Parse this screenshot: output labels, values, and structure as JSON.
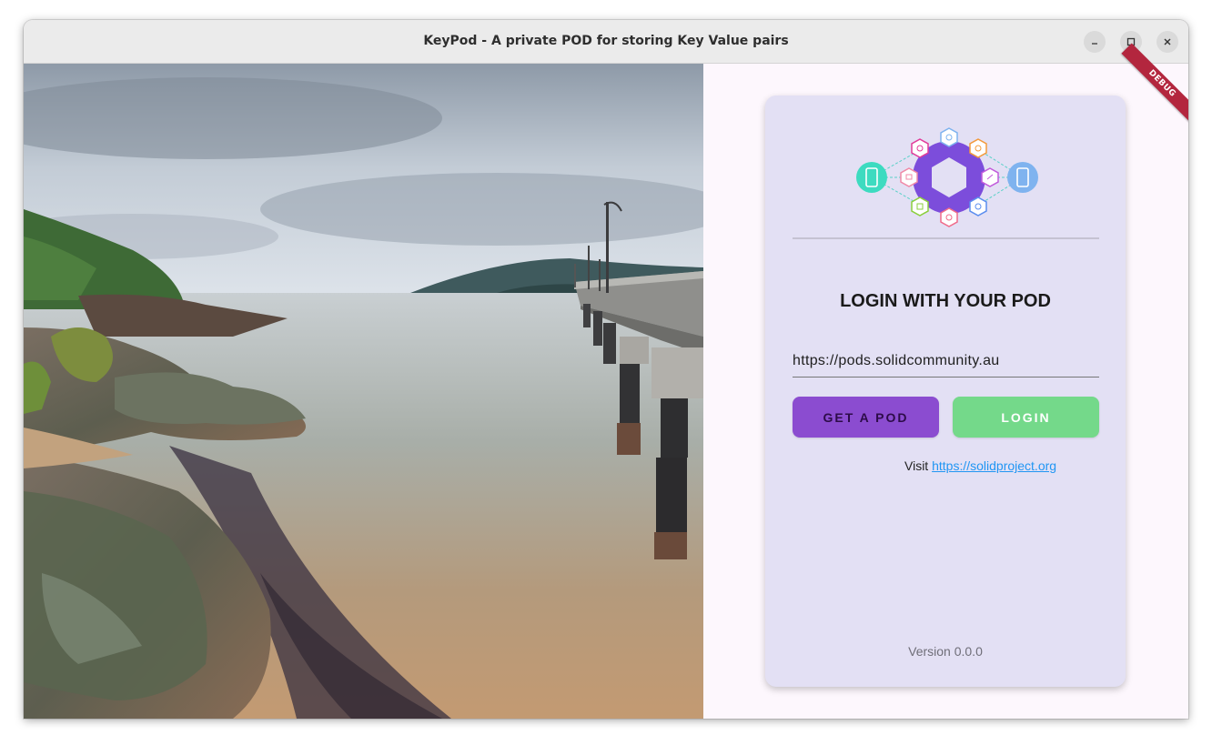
{
  "window": {
    "title": "KeyPod - A private POD for storing Key Value pairs",
    "controls": [
      "minimize-icon",
      "maximize-icon",
      "close-icon"
    ]
  },
  "debug_banner": "DEBUG",
  "login": {
    "heading": "LOGIN WITH YOUR POD",
    "server_url": "https://pods.solidcommunity.au",
    "get_pod_label": "GET A POD",
    "login_label": "LOGIN",
    "visit_prefix": "Visit",
    "visit_link": "https://solidproject.org",
    "version": "Version 0.0.0"
  },
  "colors": {
    "get_pod_button": "#8b4cd0",
    "login_button": "#74d98a",
    "card_background": "#e3e0f4",
    "link": "#2196f3",
    "debug_banner": "#b3263e"
  },
  "icons": {
    "logo": "solid-pod-network-logo",
    "photo": "coastal-pier-photo"
  }
}
